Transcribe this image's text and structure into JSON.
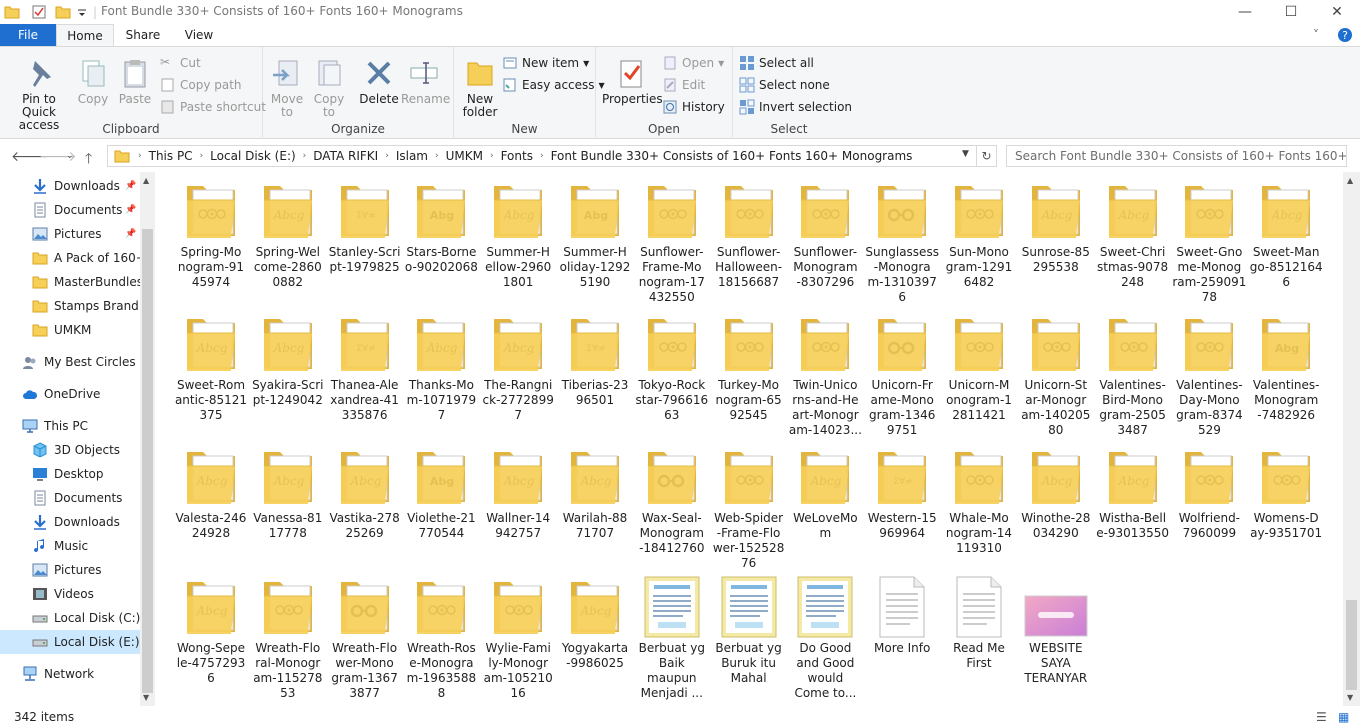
{
  "window": {
    "title": "Font Bundle 330+ Consists of 160+ Fonts 160+ Monograms",
    "controls": {
      "minimize": "—",
      "maximize": "☐",
      "close": "✕"
    }
  },
  "tabs": {
    "file": "File",
    "home": "Home",
    "share": "Share",
    "view": "View"
  },
  "ribbon": {
    "clipboard": {
      "label": "Clipboard",
      "pin": "Pin to Quick access",
      "copy": "Copy",
      "paste": "Paste",
      "cut": "Cut",
      "copy_path": "Copy path",
      "paste_shortcut": "Paste shortcut"
    },
    "organize": {
      "label": "Organize",
      "move_to": "Move to",
      "copy_to": "Copy to",
      "delete": "Delete",
      "rename": "Rename"
    },
    "new": {
      "label": "New",
      "new_folder": "New folder",
      "new_item": "New item",
      "easy_access": "Easy access"
    },
    "open": {
      "label": "Open",
      "properties": "Properties",
      "open": "Open",
      "edit": "Edit",
      "history": "History"
    },
    "select": {
      "label": "Select",
      "select_all": "Select all",
      "select_none": "Select none",
      "invert": "Invert selection"
    }
  },
  "address": {
    "crumbs": [
      "This PC",
      "Local Disk (E:)",
      "DATA RIFKI",
      "Islam",
      "UMKM",
      "Fonts",
      "Font Bundle 330+ Consists of 160+ Fonts 160+ Monograms"
    ],
    "search_placeholder": "Search Font Bundle 330+ Consists of 160+ Fonts 160+ M..."
  },
  "nav": [
    {
      "label": "Downloads",
      "icon": "download-arrow-icon",
      "pinned": true
    },
    {
      "label": "Documents",
      "icon": "documents-icon",
      "pinned": true
    },
    {
      "label": "Pictures",
      "icon": "pictures-icon",
      "pinned": true
    },
    {
      "label": "A Pack of 160+ F",
      "icon": "folder-icon",
      "pinned": false
    },
    {
      "label": "MasterBundles",
      "icon": "folder-icon",
      "pinned": false
    },
    {
      "label": "Stamps Brand",
      "icon": "folder-icon",
      "pinned": false
    },
    {
      "label": "UMKM",
      "icon": "folder-icon",
      "pinned": false
    },
    {
      "label": "My Best Circles Dr",
      "icon": "people-icon",
      "pinned": false
    },
    {
      "label": "OneDrive",
      "icon": "cloud-icon",
      "pinned": false
    },
    {
      "label": "This PC",
      "icon": "computer-icon",
      "pinned": false
    },
    {
      "label": "3D Objects",
      "icon": "cube-icon",
      "pinned": false
    },
    {
      "label": "Desktop",
      "icon": "desktop-icon",
      "pinned": false
    },
    {
      "label": "Documents",
      "icon": "documents-icon",
      "pinned": false
    },
    {
      "label": "Downloads",
      "icon": "download-arrow-icon",
      "pinned": false
    },
    {
      "label": "Music",
      "icon": "music-note-icon",
      "pinned": false
    },
    {
      "label": "Pictures",
      "icon": "pictures-icon",
      "pinned": false
    },
    {
      "label": "Videos",
      "icon": "film-icon",
      "pinned": false
    },
    {
      "label": "Local Disk (C:)",
      "icon": "drive-icon",
      "pinned": false
    },
    {
      "label": "Local Disk (E:)",
      "icon": "drive-icon",
      "pinned": false,
      "selected": true
    },
    {
      "label": "Network",
      "icon": "network-icon",
      "pinned": false
    }
  ],
  "items": [
    {
      "name": "Spring-Monogram-9145974",
      "lines": [
        "Spring-Mo",
        "nogram-91",
        "45974"
      ],
      "type": "folder",
      "preview": "floral"
    },
    {
      "name": "Spring-Welcome-28600882",
      "lines": [
        "Spring-Wel",
        "come-2860",
        "0882"
      ],
      "type": "folder",
      "preview": "script"
    },
    {
      "name": "Stanley-Script-1979825",
      "lines": [
        "Stanley-Scri",
        "pt-1979825"
      ],
      "type": "folder",
      "preview": "symbols"
    },
    {
      "name": "Stars-Borneo-90202068",
      "lines": [
        "Stars-Borne",
        "o-90202068"
      ],
      "type": "folder",
      "preview": "bold"
    },
    {
      "name": "Summer-Hellow-29601801",
      "lines": [
        "Summer-H",
        "ellow-2960",
        "1801"
      ],
      "type": "folder",
      "preview": "script"
    },
    {
      "name": "Summer-Holiday-12925190",
      "lines": [
        "Summer-H",
        "oliday-1292",
        "5190"
      ],
      "type": "folder",
      "preview": "bold"
    },
    {
      "name": "Sunflower-Frame-Monogram-17432550",
      "lines": [
        "Sunflower-",
        "Frame-Mo",
        "nogram-17",
        "432550"
      ],
      "type": "folder",
      "preview": "floral"
    },
    {
      "name": "Sunflower-Halloween-18156687",
      "lines": [
        "Sunflower-",
        "Halloween-",
        "18156687"
      ],
      "type": "folder",
      "preview": "floral"
    },
    {
      "name": "Sunflower-Monogram-8307296",
      "lines": [
        "Sunflower-",
        "Monogram",
        "-8307296"
      ],
      "type": "folder",
      "preview": "floral"
    },
    {
      "name": "Sunglassess-Monogram-13103976",
      "lines": [
        "Sunglassess",
        "-Monogra",
        "m-1310397",
        "6"
      ],
      "type": "folder",
      "preview": "rings"
    },
    {
      "name": "Sun-Monogram-12916482",
      "lines": [
        "Sun-Mono",
        "gram-1291",
        "6482"
      ],
      "type": "folder",
      "preview": "floral"
    },
    {
      "name": "Sunrose-85295538",
      "lines": [
        "Sunrose-85",
        "295538"
      ],
      "type": "folder",
      "preview": "script"
    },
    {
      "name": "Sweet-Christmas-9078248",
      "lines": [
        "Sweet-Chri",
        "stmas-9078",
        "248"
      ],
      "type": "folder",
      "preview": "script"
    },
    {
      "name": "Sweet-Gnome-Monogram-25909178",
      "lines": [
        "Sweet-Gno",
        "me-Monog",
        "ram-259091",
        "78"
      ],
      "type": "folder",
      "preview": "floral"
    },
    {
      "name": "Sweet-Mango-85121646",
      "lines": [
        "Sweet-Man",
        "go-8512164",
        "6"
      ],
      "type": "folder",
      "preview": "script"
    },
    {
      "name": "Sweet-Romantic-85121375",
      "lines": [
        "Sweet-Rom",
        "antic-85121",
        "375"
      ],
      "type": "folder",
      "preview": "script"
    },
    {
      "name": "Syakira-Script-1249042",
      "lines": [
        "Syakira-Scri",
        "pt-1249042"
      ],
      "type": "folder",
      "preview": "script"
    },
    {
      "name": "Thanea-Alexandrea-41335876",
      "lines": [
        "Thanea-Ale",
        "xandrea-41",
        "335876"
      ],
      "type": "folder",
      "preview": "symbols"
    },
    {
      "name": "Thanks-Mom-10719797",
      "lines": [
        "Thanks-Mo",
        "m-1071979",
        "7"
      ],
      "type": "folder",
      "preview": "script"
    },
    {
      "name": "The-Rangnick-27728997",
      "lines": [
        "The-Rangni",
        "ck-2772899",
        "7"
      ],
      "type": "folder",
      "preview": "script"
    },
    {
      "name": "Tiberias-2396501",
      "lines": [
        "Tiberias-23",
        "96501"
      ],
      "type": "folder",
      "preview": "symbols"
    },
    {
      "name": "Tokyo-Rockstar-79661663",
      "lines": [
        "Tokyo-Rock",
        "star-796616",
        "63"
      ],
      "type": "folder",
      "preview": "floral"
    },
    {
      "name": "Turkey-Monogram-6592545",
      "lines": [
        "Turkey-Mo",
        "nogram-65",
        "92545"
      ],
      "type": "folder",
      "preview": "floral"
    },
    {
      "name": "Twin-Unicorns-and-Heart-Monogram-14023...",
      "lines": [
        "Twin-Unico",
        "rns-and-He",
        "art-Monogr",
        "am-14023..."
      ],
      "type": "folder",
      "preview": "floral"
    },
    {
      "name": "Unicorn-Frame-Monogram-13469751",
      "lines": [
        "Unicorn-Fr",
        "ame-Mono",
        "gram-1346",
        "9751"
      ],
      "type": "folder",
      "preview": "rings"
    },
    {
      "name": "Unicorn-Monogram-12811421",
      "lines": [
        "Unicorn-M",
        "onogram-1",
        "2811421"
      ],
      "type": "folder",
      "preview": "floral"
    },
    {
      "name": "Unicorn-Star-Monogram-14020580",
      "lines": [
        "Unicorn-St",
        "ar-Monogr",
        "am-140205",
        "80"
      ],
      "type": "folder",
      "preview": "floral"
    },
    {
      "name": "Valentines-Bird-Monogram-25053487",
      "lines": [
        "Valentines-",
        "Bird-Mono",
        "gram-2505",
        "3487"
      ],
      "type": "folder",
      "preview": "floral"
    },
    {
      "name": "Valentines-Day-Monogram-8374529",
      "lines": [
        "Valentines-",
        "Day-Mono",
        "gram-8374",
        "529"
      ],
      "type": "folder",
      "preview": "floral"
    },
    {
      "name": "Valentines-Monogram-7482926",
      "lines": [
        "Valentines-",
        "Monogram",
        "-7482926"
      ],
      "type": "folder",
      "preview": "bold"
    },
    {
      "name": "Valesta-24624928",
      "lines": [
        "Valesta-246",
        "24928"
      ],
      "type": "folder",
      "preview": "script"
    },
    {
      "name": "Vanessa-8117778",
      "lines": [
        "Vanessa-81",
        "17778"
      ],
      "type": "folder",
      "preview": "script"
    },
    {
      "name": "Vastika-27825269",
      "lines": [
        "Vastika-278",
        "25269"
      ],
      "type": "folder",
      "preview": "script"
    },
    {
      "name": "Violethe-21770544",
      "lines": [
        "Violethe-21",
        "770544"
      ],
      "type": "folder",
      "preview": "bold"
    },
    {
      "name": "Wallner-14942757",
      "lines": [
        "Wallner-14",
        "942757"
      ],
      "type": "folder",
      "preview": "script"
    },
    {
      "name": "Warilah-8871707",
      "lines": [
        "Warilah-88",
        "71707"
      ],
      "type": "folder",
      "preview": "script"
    },
    {
      "name": "Wax-Seal-Monogram-18412760",
      "lines": [
        "Wax-Seal-",
        "Monogram",
        "-18412760"
      ],
      "type": "folder",
      "preview": "rings"
    },
    {
      "name": "Web-Spider-Frame-Flower-15252876",
      "lines": [
        "Web-Spider",
        "-Frame-Flo",
        "wer-152528",
        "76"
      ],
      "type": "folder",
      "preview": "floral"
    },
    {
      "name": "WeLoveMom",
      "lines": [
        "WeLoveMo",
        "m"
      ],
      "type": "folder",
      "preview": "script"
    },
    {
      "name": "Western-15969964",
      "lines": [
        "Western-15",
        "969964"
      ],
      "type": "folder",
      "preview": "symbols"
    },
    {
      "name": "Whale-Monogram-14119310",
      "lines": [
        "Whale-Mo",
        "nogram-14",
        "119310"
      ],
      "type": "folder",
      "preview": "floral"
    },
    {
      "name": "Winothe-28034290",
      "lines": [
        "Winothe-28",
        "034290"
      ],
      "type": "folder",
      "preview": "script"
    },
    {
      "name": "Wistha-Belle-93013550",
      "lines": [
        "Wistha-Bell",
        "e-93013550"
      ],
      "type": "folder",
      "preview": "script"
    },
    {
      "name": "Wolfriend-7960099",
      "lines": [
        "Wolfriend-",
        "7960099"
      ],
      "type": "folder",
      "preview": "floral"
    },
    {
      "name": "Womens-Day-9351701",
      "lines": [
        "Womens-D",
        "ay-9351701"
      ],
      "type": "folder",
      "preview": "floral"
    },
    {
      "name": "Wong-Sepele-47572936",
      "lines": [
        "Wong-Sepe",
        "le-47572936"
      ],
      "type": "folder",
      "preview": "script"
    },
    {
      "name": "Wreath-Floral-Monogram-11527853",
      "lines": [
        "Wreath-Flo",
        "ral-Monogr",
        "am-115278",
        "53"
      ],
      "type": "folder",
      "preview": "floral"
    },
    {
      "name": "Wreath-Flower-Monogram-13673877",
      "lines": [
        "Wreath-Flo",
        "wer-Mono",
        "gram-1367",
        "3877"
      ],
      "type": "folder",
      "preview": "rings"
    },
    {
      "name": "Wreath-Rose-Monogram-19635888",
      "lines": [
        "Wreath-Ros",
        "e-Monogra",
        "m-1963588",
        "8"
      ],
      "type": "folder",
      "preview": "floral"
    },
    {
      "name": "Wylie-Family-Monogram-10521016",
      "lines": [
        "Wylie-Fami",
        "ly-Monogr",
        "am-105210",
        "16"
      ],
      "type": "folder",
      "preview": "floral"
    },
    {
      "name": "Yogyakarta-9986025",
      "lines": [
        "Yogyakarta",
        "-9986025"
      ],
      "type": "folder",
      "preview": "script"
    },
    {
      "name": "Berbuat yg Baik maupun Menjadi ...",
      "lines": [
        "Berbuat yg",
        "Baik",
        "maupun",
        "Menjadi ..."
      ],
      "type": "poster",
      "preview": "poster"
    },
    {
      "name": "Berbuat yg Buruk itu Mahal",
      "lines": [
        "Berbuat yg",
        "Buruk itu",
        "Mahal"
      ],
      "type": "poster",
      "preview": "poster"
    },
    {
      "name": "Do Good and Good would Come to...",
      "lines": [
        "Do Good",
        "and Good",
        "would",
        "Come to..."
      ],
      "type": "poster",
      "preview": "poster"
    },
    {
      "name": "More Info",
      "lines": [
        "More Info"
      ],
      "type": "doc",
      "preview": "doc"
    },
    {
      "name": "Read Me First",
      "lines": [
        "Read Me",
        "First"
      ],
      "type": "doc",
      "preview": "doc"
    },
    {
      "name": "WEBSITE SAYA TERANYAR",
      "lines": [
        "WEBSITE",
        "SAYA",
        "TERANYAR"
      ],
      "type": "image",
      "preview": "banner"
    }
  ],
  "status": {
    "count": "342 items"
  },
  "colors": {
    "accent": "#1e6fd0",
    "folder": "#f6cf58",
    "selected": "#cce8ff"
  }
}
